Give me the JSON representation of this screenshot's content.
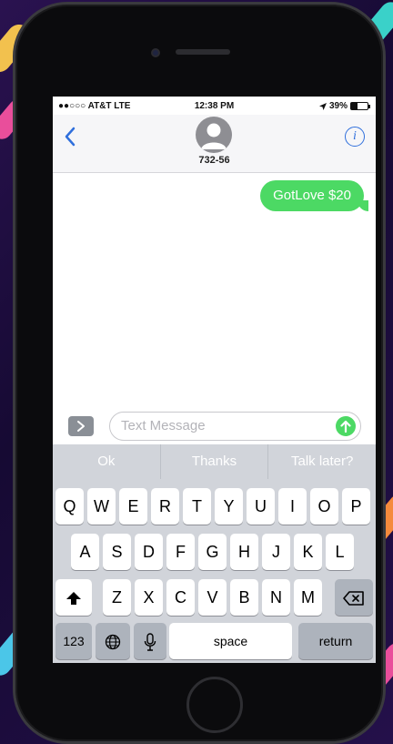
{
  "status_bar": {
    "carrier": "●●○○○ AT&T  LTE",
    "time": "12:38 PM",
    "battery": "39%",
    "battery_level": 0.39
  },
  "header": {
    "contact": "732-56"
  },
  "messages": [
    {
      "text": "GotLove $20",
      "sender": "me"
    }
  ],
  "input": {
    "placeholder": "Text Message"
  },
  "suggestions": [
    "Ok",
    "Thanks",
    "Talk later?"
  ],
  "keyboard": {
    "row1": [
      "Q",
      "W",
      "E",
      "R",
      "T",
      "Y",
      "U",
      "I",
      "O",
      "P"
    ],
    "row2": [
      "A",
      "S",
      "D",
      "F",
      "G",
      "H",
      "J",
      "K",
      "L"
    ],
    "row3": [
      "Z",
      "X",
      "C",
      "V",
      "B",
      "N",
      "M"
    ],
    "numbers_label": "123",
    "space_label": "space",
    "return_label": "return"
  },
  "colors": {
    "bubble": "#4cd964",
    "link": "#2f6fdc",
    "keyboard_bg": "#d1d4da"
  },
  "icons": [
    "back-chevron-icon",
    "contact-avatar-icon",
    "info-icon",
    "app-drawer-icon",
    "send-arrow-icon",
    "shift-icon",
    "globe-icon",
    "microphone-icon",
    "backspace-icon"
  ]
}
